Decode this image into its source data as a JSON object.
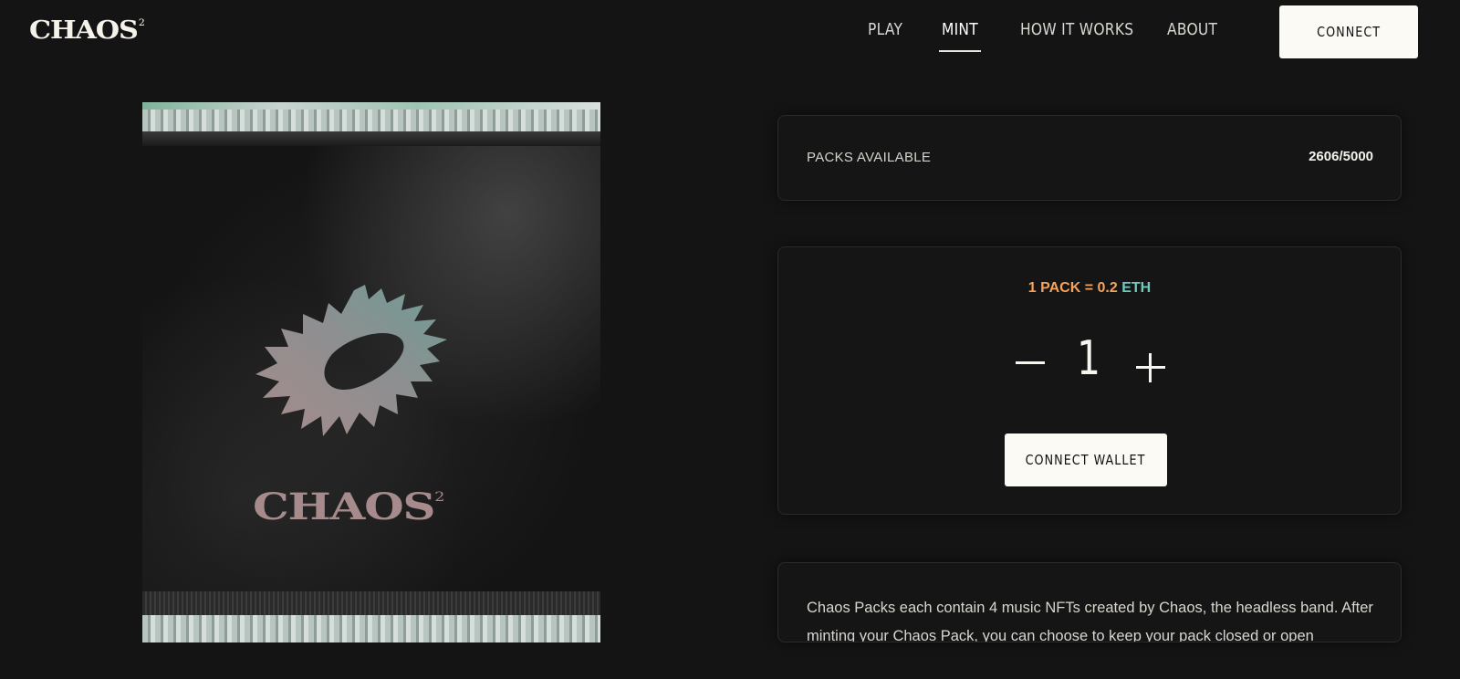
{
  "header": {
    "logo": "CHAOS",
    "logo_mark": "2",
    "nav": [
      {
        "label": "PLAY",
        "active": false
      },
      {
        "label": "MINT",
        "active": true
      },
      {
        "label": "HOW IT WORKS",
        "active": false
      },
      {
        "label": "ABOUT",
        "active": false
      }
    ],
    "connect_label": "CONNECT"
  },
  "pack": {
    "wordmark": "CHAOS",
    "wordmark_mark": "2"
  },
  "availability": {
    "label": "PACKS AVAILABLE",
    "value": "2606/5000"
  },
  "mint": {
    "price_prefix": "1 PACK = 0.2",
    "price_currency": "ETH",
    "quantity": "1",
    "connect_wallet_label": "CONNECT WALLET"
  },
  "description": {
    "text": "Chaos Packs each contain 4 music NFTs created by Chaos, the headless band. After minting your Chaos Pack, you can choose to keep your pack closed or open"
  },
  "colors": {
    "background": "#141414",
    "price_orange": "#f3a35d",
    "price_teal": "#6fc9bd",
    "button_bg": "#fbfaf5"
  },
  "icons": [
    "minus-icon",
    "plus-icon"
  ]
}
